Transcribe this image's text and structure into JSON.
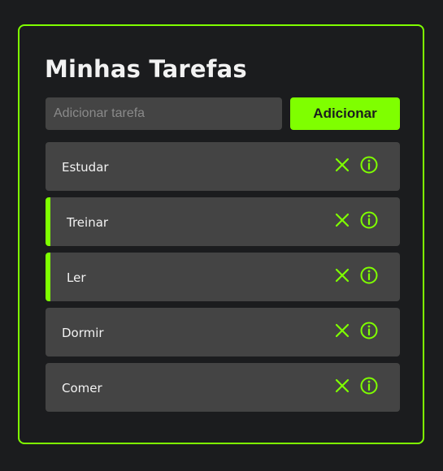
{
  "header": {
    "title": "Minhas Tarefas"
  },
  "form": {
    "input_placeholder": "Adicionar tarefa",
    "input_value": "",
    "add_button_label": "Adicionar"
  },
  "tasks": [
    {
      "label": "Estudar",
      "completed": false
    },
    {
      "label": "Treinar",
      "completed": true
    },
    {
      "label": "Ler",
      "completed": true
    },
    {
      "label": "Dormir",
      "completed": false
    },
    {
      "label": "Comer",
      "completed": false
    }
  ],
  "icons": {
    "remove": "close-icon",
    "details": "info-icon"
  },
  "colors": {
    "accent": "#7fff00",
    "background": "#1b1c1e",
    "item_background": "#444444",
    "text": "#f2f2f2"
  }
}
